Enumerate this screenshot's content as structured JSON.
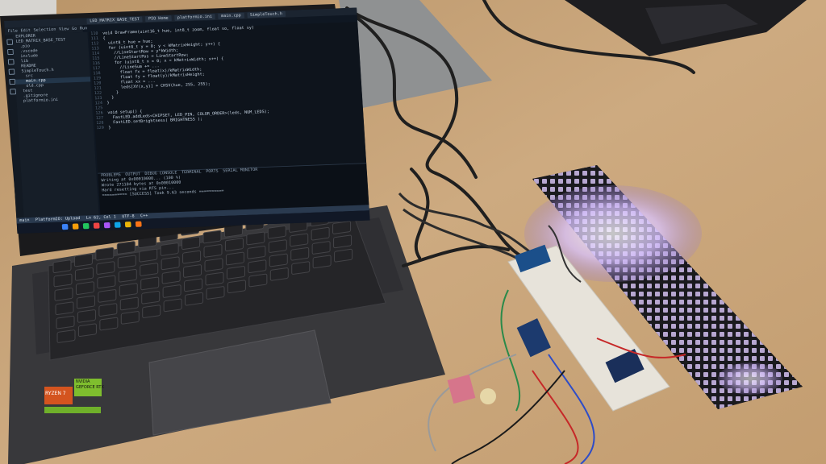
{
  "scene": {
    "colors": {
      "table": "#c8a57c",
      "laptop_body": "#3a3a3d",
      "keys": "#2b2b2e",
      "led_glow": "#c9a6ff",
      "breadboard": "#e8e4dc",
      "cables": "#1f1f1f"
    }
  },
  "ide": {
    "tabs": [
      "LED_MATRIX_BASE_TEST",
      "PIO Home",
      "platformio.ini",
      "main.cpp",
      "SimpleTouch.h"
    ],
    "menu": [
      "File",
      "Edit",
      "Selection",
      "View",
      "Go",
      "Run"
    ],
    "explorer": {
      "header": "EXPLORER",
      "items": [
        "LED_MATRIX_BASE_TEST",
        ".pio",
        ".vscode",
        "include",
        "lib",
        "README",
        "SimpleTouch.h",
        "src",
        "main.cpp",
        "old.cpp",
        "test",
        ".gitignore",
        "platformio.ini"
      ]
    },
    "code_lines": [
      "void DrawFrame(uint16_t hue, int8_t zoom, float so, float sy)",
      "{",
      "  uint8_t hue = hue;",
      "  for (uint8_t y = 0; y < kMatrixHeight; y++) {",
      "    //LineStartRow = y*kWidth;",
      "    //LineStartPos = LineStartRow;",
      "    for (uint8_t x = 0; x < kMatrixWidth; x++) {",
      "      //LineSum += ...",
      "      float fx = float(x)/kMatrixWidth;",
      "      float fy = float(y)/kMatrixHeight;",
      "      float xx = ...",
      "      leds[XY(x,y)] = CHSV(hue, 255, 255);",
      "    }",
      "  }",
      "}",
      "",
      "void setup() {",
      "  FastLED.addLeds<CHIPSET, LED_PIN, COLOR_ORDER>(leds, NUM_LEDS);",
      "  FastLED.setBrightness( BRIGHTNESS );",
      "}"
    ],
    "panel_tabs": [
      "PROBLEMS",
      "OUTPUT",
      "DEBUG CONSOLE",
      "TERMINAL",
      "PORTS",
      "SERIAL MONITOR"
    ],
    "terminal": [
      "Writing at 0x00010000... (100 %)",
      "Wrote 271104 bytes at 0x00010000",
      "Hard resetting via RTS pin...",
      "========== [SUCCESS] Took 9.63 seconds =========="
    ],
    "status": [
      "main",
      "PlatformIO: Upload",
      "Ln 62, Col 1",
      "UTF-8",
      "C++"
    ],
    "taskbar_icon_colors": [
      "#3b82f6",
      "#f59e0b",
      "#22c55e",
      "#ef4444",
      "#a855f7",
      "#0ea5e9",
      "#eab308",
      "#f97316"
    ],
    "clock": ""
  },
  "stickers": {
    "cpu": "RYZEN 7",
    "gpu": "GEFORCE RTX",
    "brand": "NVIDIA"
  }
}
